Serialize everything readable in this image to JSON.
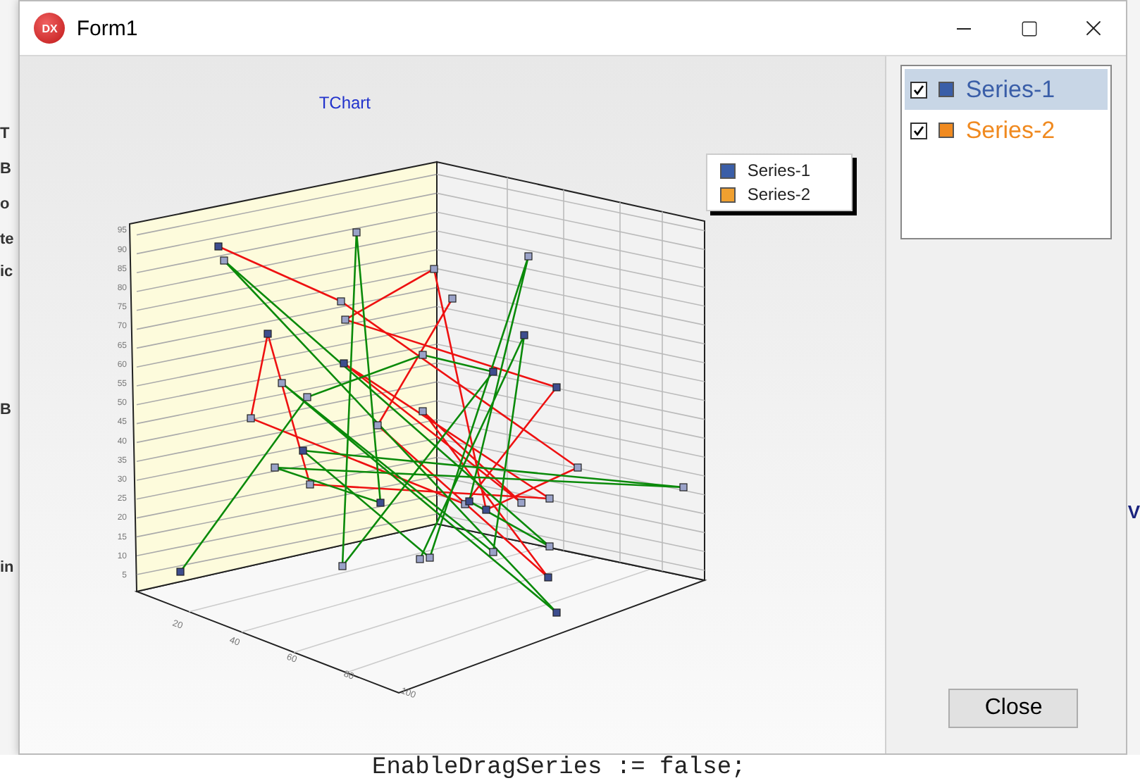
{
  "background": {
    "left_fragments": [
      "T",
      "B",
      "o",
      "te",
      "ic",
      "B",
      "in"
    ],
    "right_fragments": [
      "V"
    ],
    "code_line": "EnableDragSeries := false;"
  },
  "window": {
    "app_icon_text": "DX",
    "title": "Form1"
  },
  "chart": {
    "title": "TChart",
    "series": [
      {
        "name": "Series-1",
        "color": "#3a5ea8"
      },
      {
        "name": "Series-2",
        "color": "#f0a030"
      }
    ],
    "y_ticks": [
      "95",
      "90",
      "85",
      "80",
      "75",
      "70",
      "65",
      "60",
      "55",
      "50",
      "45",
      "40",
      "35",
      "30",
      "25",
      "20",
      "15",
      "10",
      "5"
    ],
    "x_ticks": [
      "20",
      "40",
      "60",
      "80",
      "100"
    ]
  },
  "series_list": [
    {
      "label": "Series-1",
      "checked": true,
      "selected": true,
      "color": "#3a5ea8"
    },
    {
      "label": "Series-2",
      "checked": true,
      "selected": false,
      "color": "#f08a20"
    }
  ],
  "close_button": "Close"
}
